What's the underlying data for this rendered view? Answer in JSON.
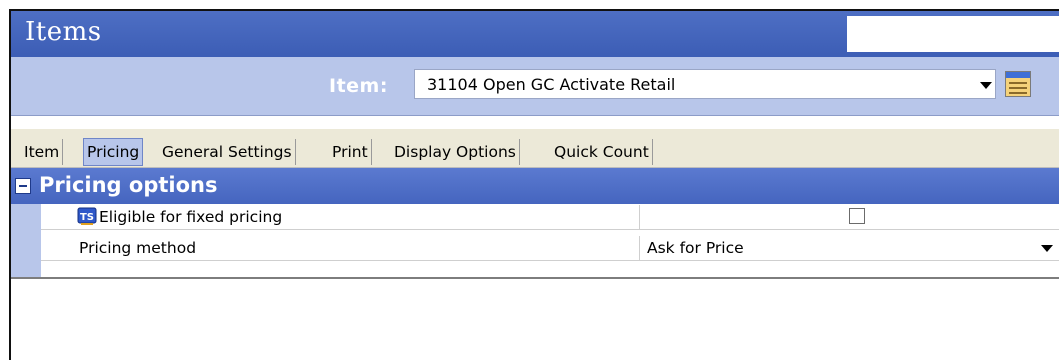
{
  "window": {
    "title": "Items"
  },
  "item_selector": {
    "label": "Item:",
    "value": "31104 Open GC Activate Retail"
  },
  "tabs": [
    {
      "label": "Item",
      "active": false
    },
    {
      "label": "Pricing",
      "active": true
    },
    {
      "label": "General Settings",
      "active": false
    },
    {
      "label": "Print",
      "active": false
    },
    {
      "label": "Display Options",
      "active": false
    },
    {
      "label": "Quick Count",
      "active": false
    }
  ],
  "pricing_options": {
    "category_title": "Pricing options",
    "rows": [
      {
        "label": "Eligible for fixed pricing",
        "checked": false,
        "icon": "ts-icon"
      },
      {
        "label": "Pricing method",
        "value": "Ask for Price"
      }
    ]
  },
  "colors": {
    "title_bar": "#4568c0",
    "item_bar": "#b8c6ea",
    "active_tab": "#b8c6ea",
    "category_header": "#4f6fc8"
  }
}
